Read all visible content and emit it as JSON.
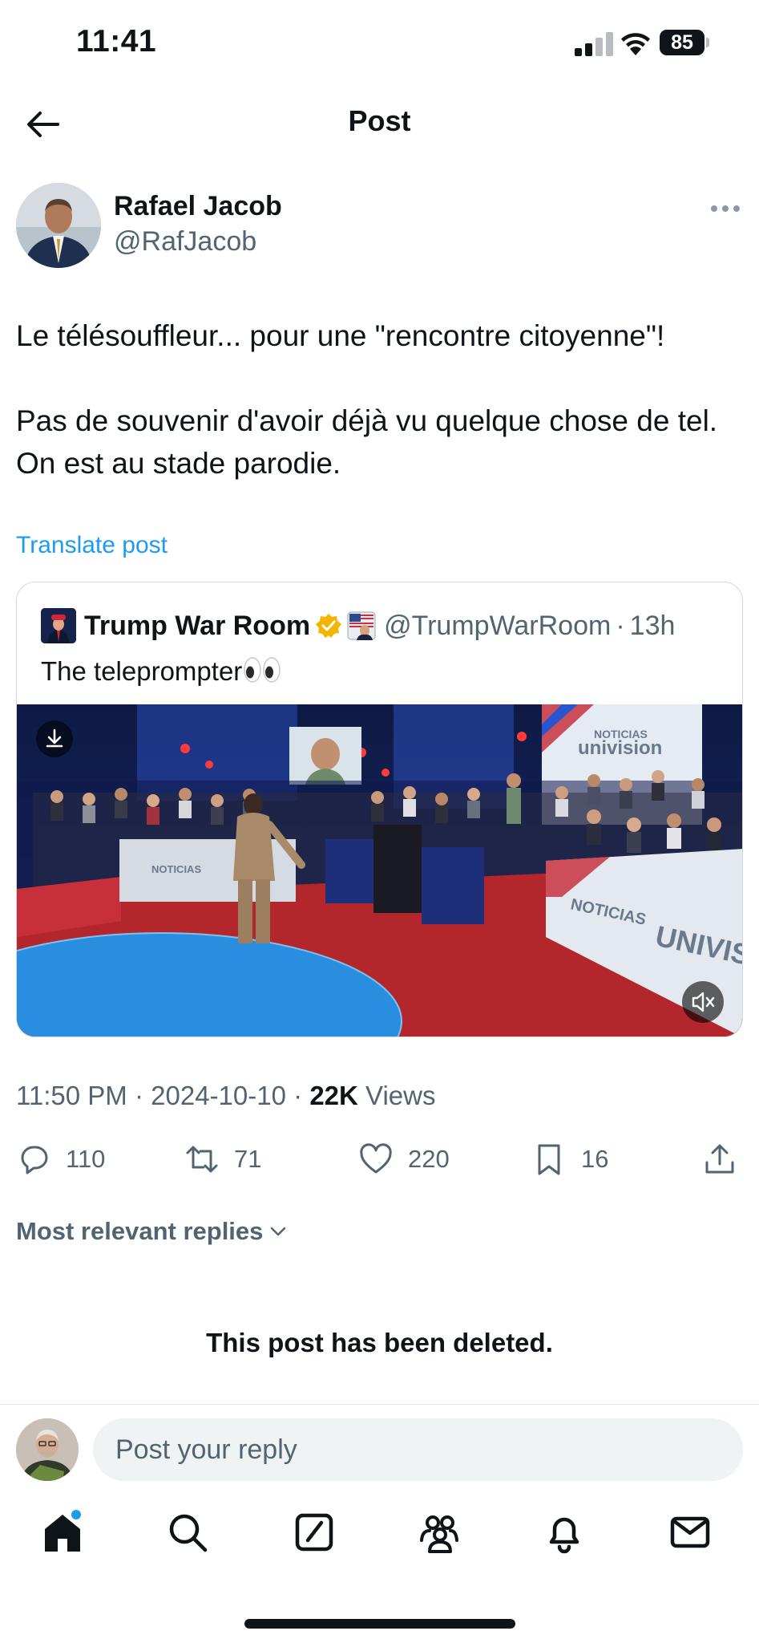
{
  "status_bar": {
    "time": "11:41",
    "battery": "85"
  },
  "header": {
    "title": "Post",
    "back_icon": "arrow-left-icon"
  },
  "post": {
    "author_name": "Rafael Jacob",
    "author_handle": "@RafJacob",
    "text": "Le télésouffleur... pour une \"rencontre citoyenne\"!\n\nPas de souvenir d'avoir déjà vu quelque chose de tel. On est au stade parodie.",
    "translate_label": "Translate post",
    "time": "11:50 PM",
    "date": "2024-10-10",
    "views_count": "22K",
    "views_label": "Views",
    "separator": "·"
  },
  "quote": {
    "name": "Trump War Room",
    "handle": "@TrumpWarRoom",
    "separator": "·",
    "time": "13h",
    "text": "The teleprompter",
    "media_overlay_text": [
      "NOTICIAS",
      "univision",
      "NOTICIAS",
      "UNIVIS"
    ]
  },
  "actions": {
    "replies": "110",
    "reposts": "71",
    "likes": "220",
    "bookmarks": "16"
  },
  "replies_sort": {
    "label": "Most relevant replies"
  },
  "deleted_notice": "This post has been deleted.",
  "reply_box": {
    "placeholder": "Post your reply"
  },
  "tab_bar": [
    "home-icon",
    "search-icon",
    "compose-icon",
    "communities-icon",
    "notifications-icon",
    "messages-icon"
  ],
  "colors": {
    "accent": "#1d9bf0",
    "text": "#0f1419",
    "secondary": "#536471",
    "verified": "#f4b400"
  }
}
